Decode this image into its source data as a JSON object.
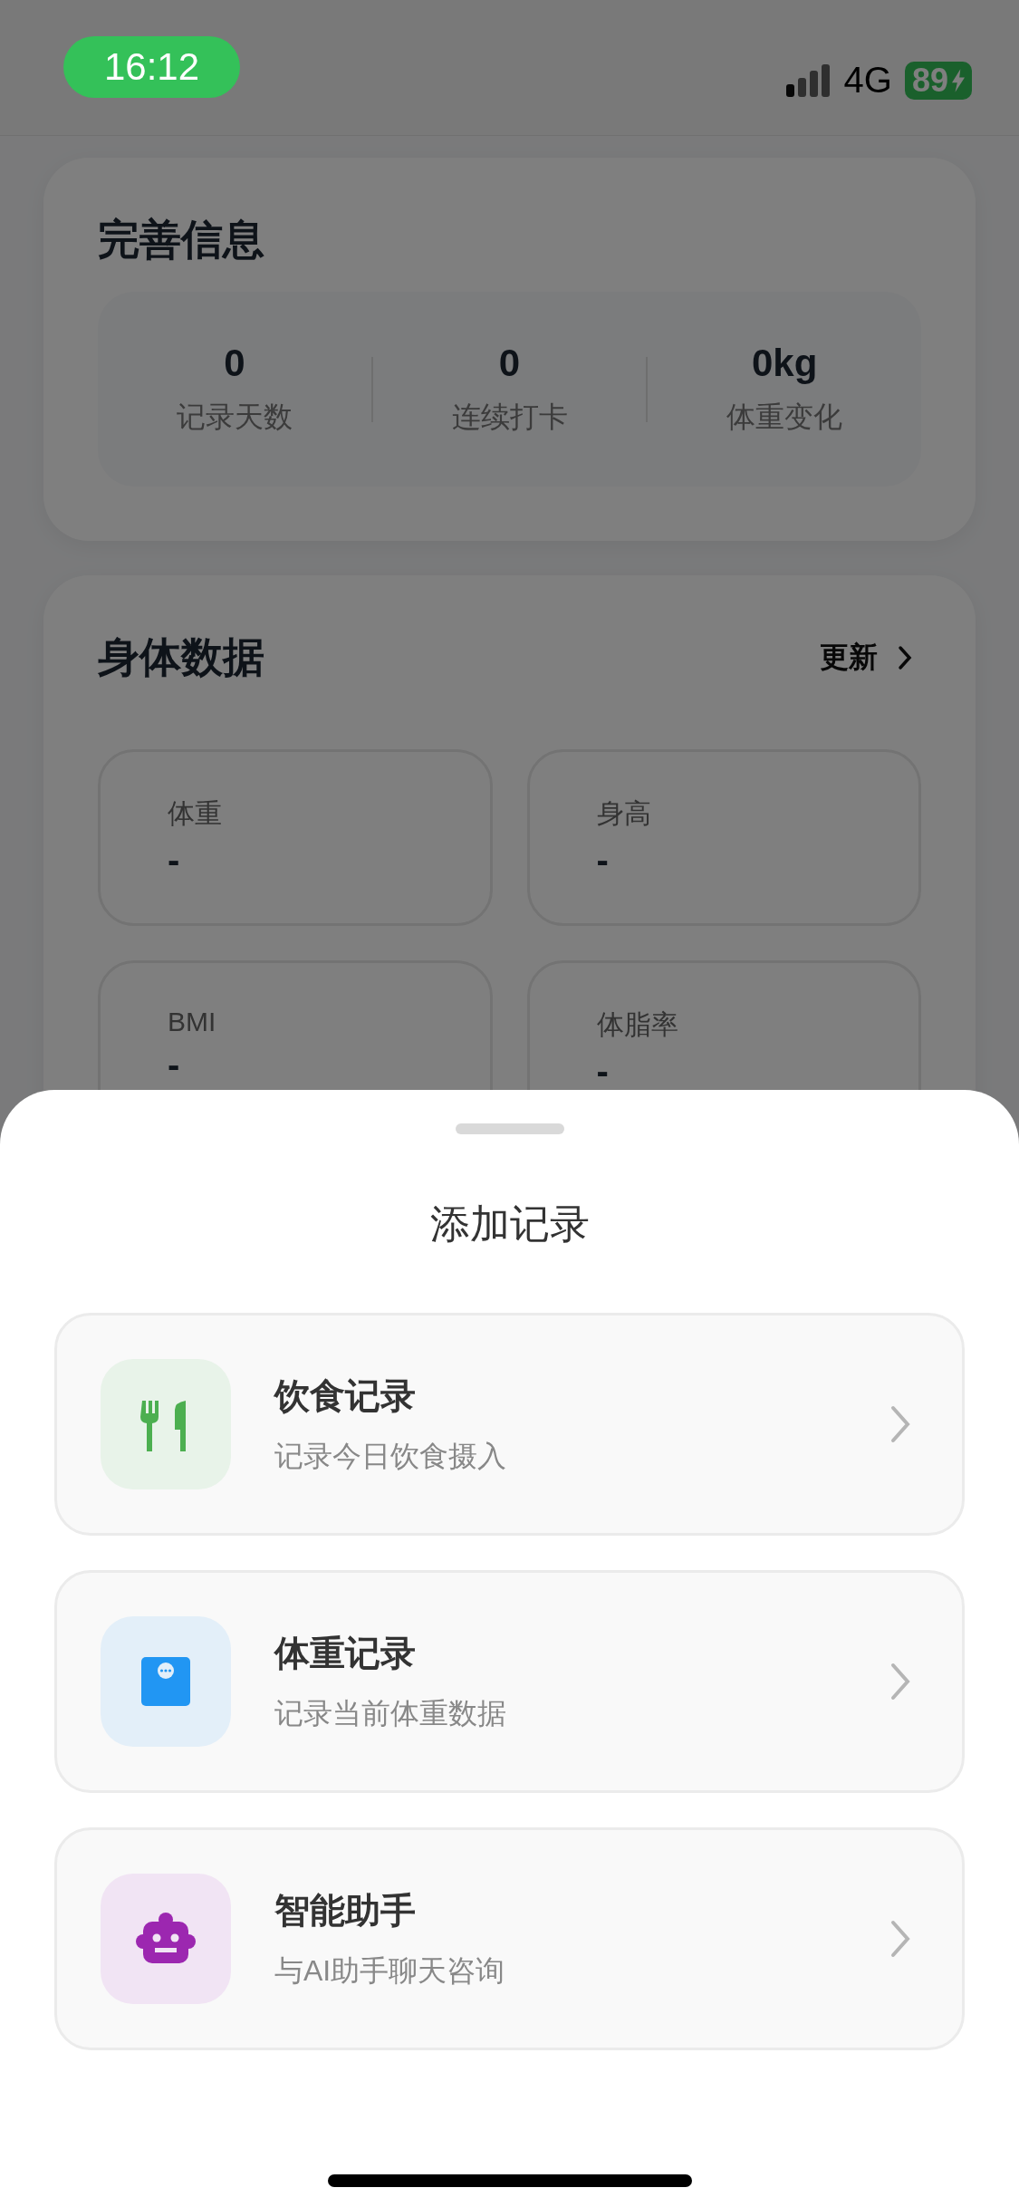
{
  "status_bar": {
    "time": "16:12",
    "network": "4G",
    "battery": "89"
  },
  "profile_card": {
    "title": "完善信息",
    "stats": [
      {
        "value": "0",
        "label": "记录天数"
      },
      {
        "value": "0",
        "label": "连续打卡"
      },
      {
        "value": "0kg",
        "label": "体重变化"
      }
    ]
  },
  "body_card": {
    "title": "身体数据",
    "action": "更新",
    "metrics": [
      {
        "label": "体重",
        "value": "-"
      },
      {
        "label": "身高",
        "value": "-"
      },
      {
        "label": "BMI",
        "value": "-"
      },
      {
        "label": "体脂率",
        "value": "-"
      }
    ]
  },
  "sheet": {
    "title": "添加记录",
    "options": [
      {
        "kind": "meal",
        "title": "饮食记录",
        "subtitle": "记录今日饮食摄入"
      },
      {
        "kind": "weight",
        "title": "体重记录",
        "subtitle": "记录当前体重数据"
      },
      {
        "kind": "assistant",
        "title": "智能助手",
        "subtitle": "与AI助手聊天咨询"
      }
    ]
  }
}
